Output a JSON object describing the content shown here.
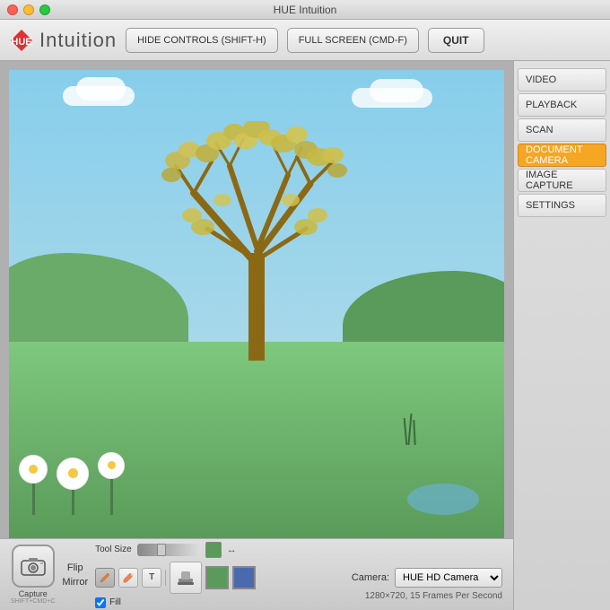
{
  "window": {
    "title": "HUE Intuition"
  },
  "titlebar": {
    "title": "HUE Intuition"
  },
  "toolbar": {
    "logo_text": "Intuition",
    "hide_controls_btn": "HIDE CONTROLS (SHIFT-H)",
    "fullscreen_btn": "FULL SCREEN (CMD-F)",
    "quit_btn": "QUIT"
  },
  "sidebar": {
    "items": [
      {
        "id": "video",
        "label": "VIDEO",
        "active": false
      },
      {
        "id": "playback",
        "label": "PLAYBACK",
        "active": false
      },
      {
        "id": "scan",
        "label": "SCAN",
        "active": false
      },
      {
        "id": "document-camera",
        "label": "DOCUMENT CAMERA",
        "active": true
      },
      {
        "id": "image-capture",
        "label": "IMAGE CAPTURE",
        "active": false
      },
      {
        "id": "settings",
        "label": "SETTINGS",
        "active": false
      }
    ]
  },
  "bottom_toolbar": {
    "capture_label": "Capture",
    "capture_shortcut": "SHIFT+CMD+C",
    "flip_label": "Flip",
    "mirror_label": "Mirror",
    "tool_size_label": "Tool Size",
    "fill_label": "Fill",
    "camera_label": "Camera:",
    "camera_value": "HUE HD Camera",
    "frame_rate": "1280×720, 15 Frames Per Second"
  },
  "colors": {
    "accent_orange": "#f5a623",
    "logo_red": "#e03030",
    "sky_blue": "#87CEEB",
    "ground_green": "#7ec87e"
  }
}
